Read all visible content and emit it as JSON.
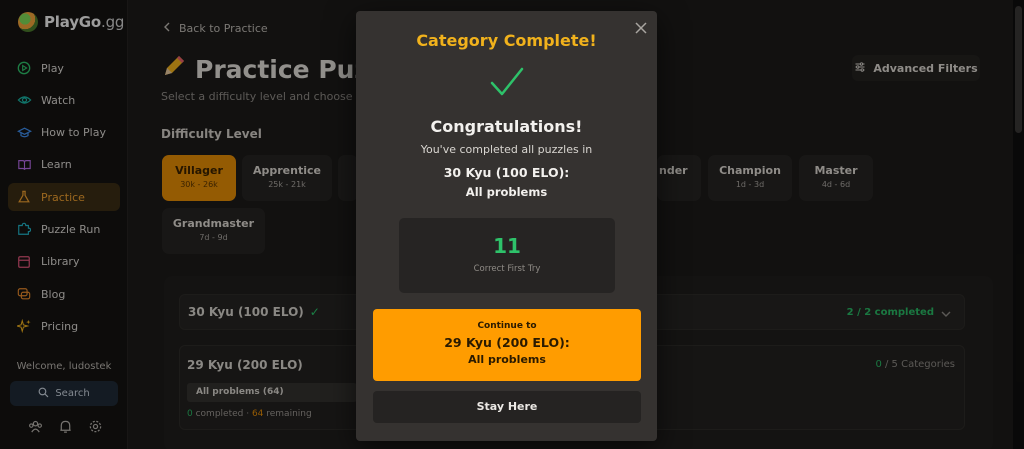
{
  "app": {
    "logo_name": "PlayGo",
    "logo_tld": ".gg"
  },
  "sidebar": {
    "items": [
      {
        "label": "Play",
        "icon": "play-circle-icon"
      },
      {
        "label": "Watch",
        "icon": "eye-icon"
      },
      {
        "label": "How to Play",
        "icon": "graduation-cap-icon"
      },
      {
        "label": "Learn",
        "icon": "book-icon"
      },
      {
        "label": "Practice",
        "icon": "flask-icon",
        "active": true
      },
      {
        "label": "Puzzle Run",
        "icon": "puzzle-icon"
      },
      {
        "label": "Library",
        "icon": "library-icon"
      },
      {
        "label": "Blog",
        "icon": "chat-bubble-icon"
      },
      {
        "label": "Pricing",
        "icon": "sparkles-icon"
      }
    ],
    "welcome": "Welcome, ludostek",
    "search_label": "Search"
  },
  "main": {
    "back_label": "Back to Practice",
    "title": "Practice Puzz",
    "subtitle": "Select a difficulty level and choose a pr",
    "advanced_filters": "Advanced Filters",
    "difficulty_label": "Difficulty Level",
    "difficulties": [
      {
        "name": "Villager",
        "range": "30k - 26k",
        "active": true
      },
      {
        "name": "Apprentice",
        "range": "25k - 21k"
      },
      {
        "name": "",
        "range": ""
      },
      {
        "name": "nder",
        "range": ""
      },
      {
        "name": "Champion",
        "range": "1d - 3d"
      },
      {
        "name": "Master",
        "range": "4d - 6d"
      },
      {
        "name": "Grandmaster",
        "range": "7d - 9d"
      }
    ],
    "rows": [
      {
        "title": "30 Kyu (100 ELO)",
        "status": "2 / 2 completed"
      },
      {
        "title": "29 Kyu (200 ELO)",
        "cats_done": "0",
        "cats_total": " / 5 Categories",
        "tag": "All problems (64)",
        "completed_num": "0",
        "completed_text": " completed · ",
        "remaining_num": "64",
        "remaining_text": " remaining"
      }
    ]
  },
  "modal": {
    "heading": "Category Complete!",
    "congrats": "Congratulations!",
    "completed_text": "You've completed all puzzles in",
    "level": "30 Kyu (100 ELO):",
    "category": "All problems",
    "stat_value": "11",
    "stat_label": "Correct First Try",
    "continue_label": "Continue to",
    "continue_level": "29 Kyu (200 ELO):",
    "continue_category": "All problems",
    "stay_label": "Stay Here"
  },
  "colors": {
    "accent": "#ff9c00",
    "success": "#2ec26a",
    "heading": "#f1b21c"
  }
}
